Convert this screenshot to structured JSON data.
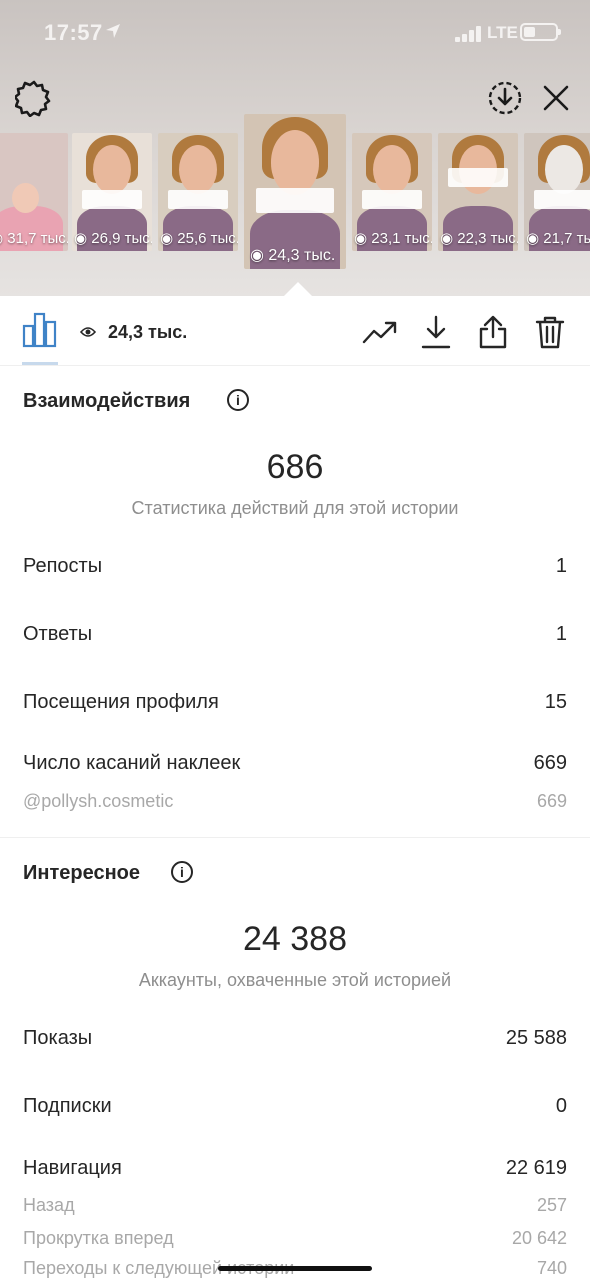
{
  "status_bar": {
    "time": "17:57",
    "network": "LTE"
  },
  "thumbnails": [
    {
      "views": "31,7 тыс."
    },
    {
      "views": "26,9 тыс."
    },
    {
      "views": "25,6 тыс."
    },
    {
      "views": "24,3 тыс.",
      "selected": true
    },
    {
      "views": "23,1 тыс."
    },
    {
      "views": "22,3 тыс."
    },
    {
      "views": "21,7 тыс."
    }
  ],
  "toolbar": {
    "reach_count": "24,3 тыс."
  },
  "interactions": {
    "title": "Взаимодействия",
    "total": "686",
    "subtitle": "Статистика действий для этой истории",
    "rows": [
      {
        "label": "Репосты",
        "value": "1"
      },
      {
        "label": "Ответы",
        "value": "1"
      },
      {
        "label": "Посещения профиля",
        "value": "15"
      },
      {
        "label": "Число касаний наклеек",
        "value": "669"
      }
    ],
    "sub_rows": [
      {
        "label": "@pollysh.cosmetic",
        "value": "669"
      }
    ]
  },
  "discovery": {
    "title": "Интересное",
    "total": "24 388",
    "subtitle": "Аккаунты, охваченные этой историей",
    "rows": [
      {
        "label": "Показы",
        "value": "25 588"
      },
      {
        "label": "Подписки",
        "value": "0"
      },
      {
        "label": "Навигация",
        "value": "22 619"
      }
    ],
    "sub_rows": [
      {
        "label": "Назад",
        "value": "257"
      },
      {
        "label": "Прокрутка вперед",
        "value": "20 642"
      },
      {
        "label": "Переходы к следующей истории",
        "value": "740"
      }
    ]
  },
  "colors": {
    "accent_tab": "#c7d9ec",
    "text": "#262626",
    "muted": "#8e8e8e"
  },
  "icons": [
    "gear-icon",
    "download-circle-icon",
    "close-icon",
    "bar-chart-icon",
    "eye-icon",
    "trending-up-icon",
    "download-icon",
    "share-icon",
    "trash-icon",
    "info-icon"
  ]
}
